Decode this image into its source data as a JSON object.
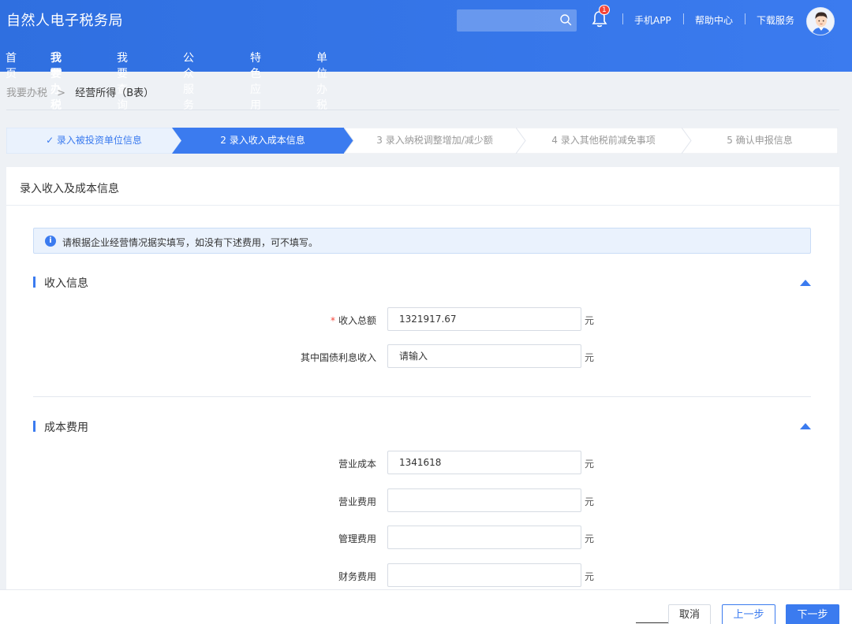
{
  "header": {
    "app_title": "自然人电子税务局",
    "notification_count": "1",
    "links": [
      "手机APP",
      "帮助中心",
      "下载服务"
    ]
  },
  "nav": {
    "items": [
      "首页",
      "我要办税",
      "我要查询",
      "公众服务",
      "特色应用",
      "单位办税"
    ],
    "active": "我要办税"
  },
  "breadcrumb": {
    "home": "我要办税",
    "separator": ">",
    "current": "经营所得（B表）"
  },
  "steps": [
    {
      "label": "✓ 录入被投资单位信息",
      "state": "done"
    },
    {
      "label": "2  录入收入成本信息",
      "state": "active"
    },
    {
      "label": "3  录入纳税调整增加/减少额",
      "state": "pending"
    },
    {
      "label": "4  录入其他税前减免事项",
      "state": "pending"
    },
    {
      "label": "5  确认申报信息",
      "state": "pending"
    }
  ],
  "card": {
    "title": "录入收入及成本信息",
    "alert": "请根据企业经营情况据实填写，如没有下述费用，可不填写。"
  },
  "income": {
    "title": "收入信息",
    "fields": [
      {
        "label": "收入总额",
        "required": true,
        "value": "1321917.67",
        "unit": "元"
      },
      {
        "label": "其中国债利息收入",
        "required": false,
        "value": "请输入",
        "unit": "元"
      }
    ]
  },
  "cost": {
    "title": "成本费用",
    "fields": [
      {
        "label": "营业成本",
        "value": "1341618",
        "unit": "元"
      },
      {
        "label": "营业费用",
        "value": "",
        "unit": "元"
      },
      {
        "label": "管理费用",
        "value": "",
        "unit": "元"
      },
      {
        "label": "财务费用",
        "value": "",
        "unit": "元"
      }
    ]
  },
  "footer": {
    "cancel": "取消",
    "prev": "上一步",
    "next": "下一步"
  },
  "colors": {
    "primary": "#3b7bef",
    "done_step_text": "#3b7bef",
    "pending_step_text": "#999999",
    "required": "#f5453a"
  }
}
